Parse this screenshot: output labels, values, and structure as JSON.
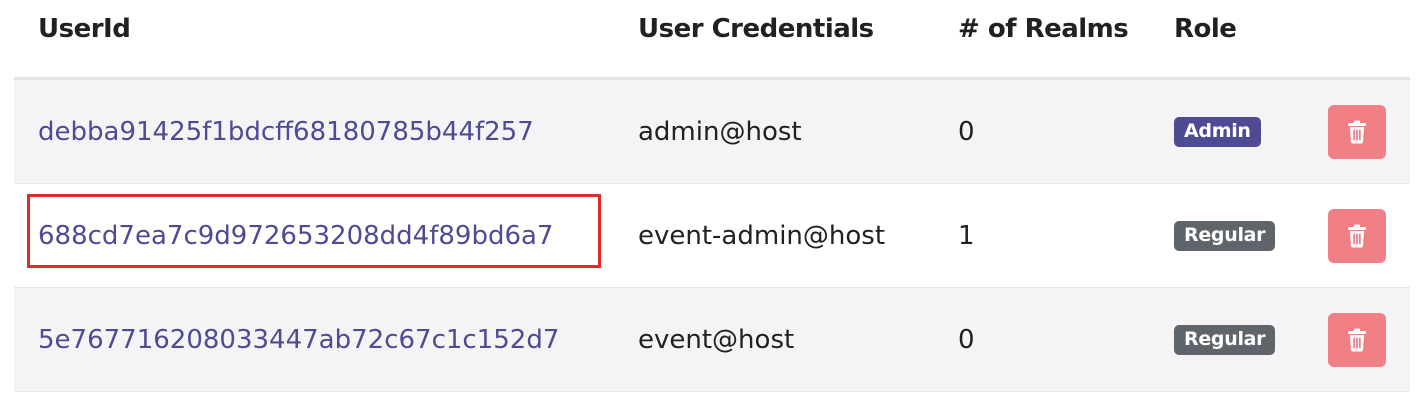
{
  "table": {
    "headers": {
      "user_id": "UserId",
      "credentials": "User Credentials",
      "realms": "# of Realms",
      "role": "Role"
    },
    "rows": [
      {
        "user_id": "debba91425f1bdcff68180785b44f257",
        "credentials": "admin@host",
        "realms": "0",
        "role": "Admin",
        "highlighted": false
      },
      {
        "user_id": "688cd7ea7c9d972653208dd4f89bd6a7",
        "credentials": "event-admin@host",
        "realms": "1",
        "role": "Regular",
        "highlighted": true
      },
      {
        "user_id": "5e767716208033447ab72c67c1c152d7",
        "credentials": "event@host",
        "realms": "0",
        "role": "Regular",
        "highlighted": false
      }
    ]
  },
  "colors": {
    "link": "#4f4b93",
    "admin_badge": "#4f4b93",
    "regular_badge": "#5e6469",
    "delete_button": "#f07f86",
    "highlight_border": "#e02b2b"
  },
  "icons": {
    "delete": "trash-icon"
  }
}
